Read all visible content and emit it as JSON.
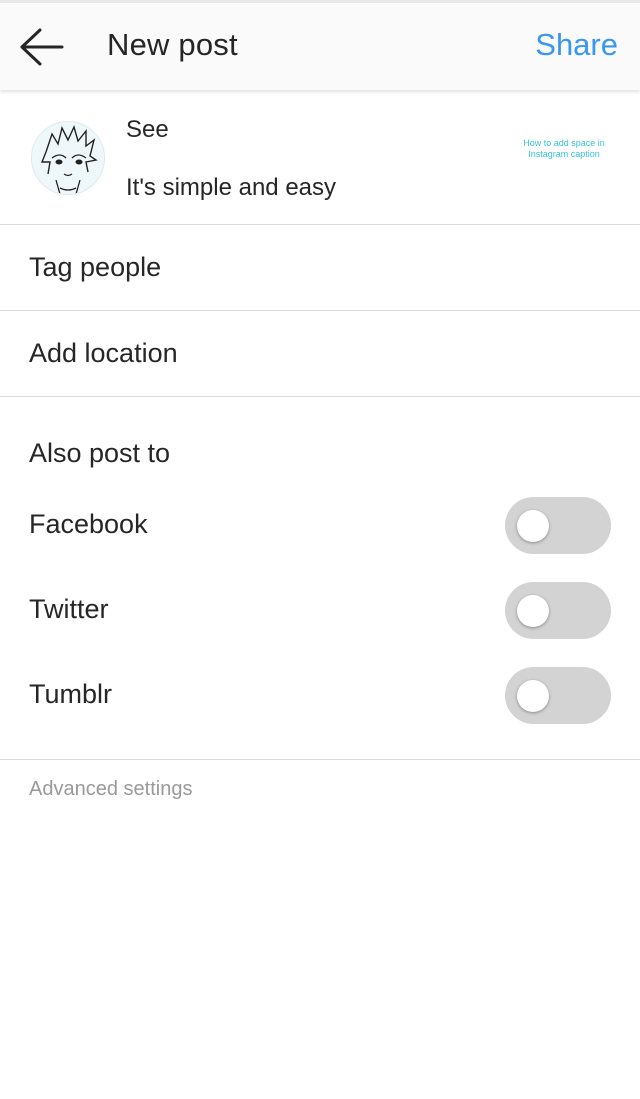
{
  "header": {
    "back_icon": "arrow-left-icon",
    "title": "New post",
    "share_label": "Share",
    "share_color": "#3897f0"
  },
  "caption": {
    "line1": "See",
    "line2": "It's simple and easy",
    "avatar_icon": "anime-avatar",
    "thumbnail_text_1": "How to add space in",
    "thumbnail_text_2": "Instagram caption"
  },
  "options": {
    "tag_people": "Tag people",
    "add_location": "Add location"
  },
  "also_post": {
    "heading": "Also post to",
    "targets": [
      {
        "label": "Facebook",
        "enabled": false
      },
      {
        "label": "Twitter",
        "enabled": false
      },
      {
        "label": "Tumblr",
        "enabled": false
      }
    ]
  },
  "advanced_settings": "Advanced settings"
}
